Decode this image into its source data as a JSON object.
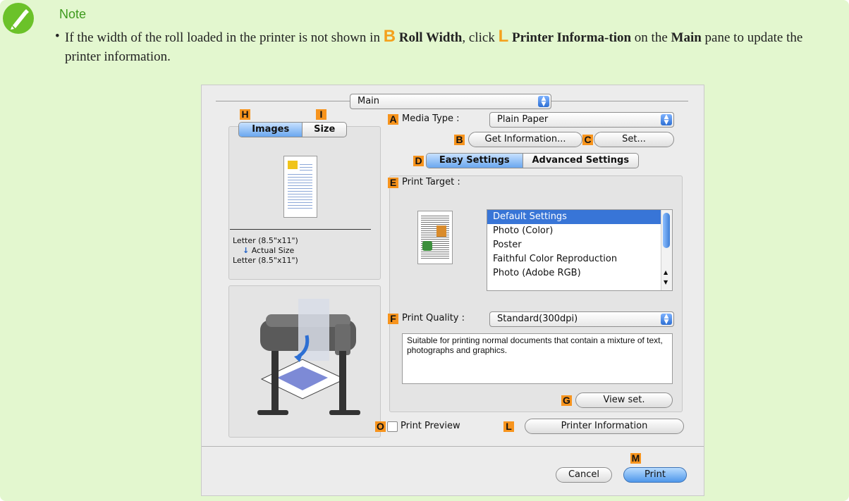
{
  "note": {
    "title": "Note",
    "bullet": "•",
    "text_1": "If the width of the roll loaded in the printer is not shown in",
    "badge_b": "B",
    "roll_width": "Roll Width",
    "text_2": ", click",
    "badge_l": "L",
    "printer_information_bold": "Printer Informa-tion",
    "text_3": "on the",
    "main_bold": "Main",
    "text_4": "pane to update the printer information."
  },
  "dialog": {
    "pane_popup": "Main",
    "tabs": {
      "label_h": "H",
      "label_i": "I",
      "images": "Images",
      "size": "Size"
    },
    "preview": {
      "paper_in": "Letter (8.5\"x11\")",
      "arrow": "↓",
      "actual_size": "Actual Size",
      "paper_out": "Letter (8.5\"x11\")"
    },
    "media_type": {
      "label_letter": "A",
      "label": "Media Type :",
      "value": "Plain Paper"
    },
    "get_info": {
      "label_letter": "B",
      "label": "Get Information..."
    },
    "set": {
      "label_letter": "C",
      "label": "Set..."
    },
    "settings_tabs": {
      "label_letter": "D",
      "easy": "Easy Settings",
      "advanced": "Advanced Settings"
    },
    "print_target": {
      "label_letter": "E",
      "label": "Print Target :",
      "items": [
        "Default Settings",
        "Photo (Color)",
        "Poster",
        "Faithful Color Reproduction",
        "Photo (Adobe RGB)"
      ],
      "selected": "Default Settings"
    },
    "print_quality": {
      "label_letter": "F",
      "label": "Print Quality :",
      "value": "Standard(300dpi)",
      "description": "Suitable for printing normal documents that contain a mixture of text, photographs and graphics."
    },
    "view_set": {
      "label_letter": "G",
      "label": "View set."
    },
    "print_preview": {
      "label_letter": "O",
      "label": "Print Preview"
    },
    "printer_information": {
      "label_letter": "L",
      "label": "Printer Information"
    },
    "cancel": "Cancel",
    "print": {
      "label_letter": "M",
      "label": "Print"
    }
  },
  "colors": {
    "note_bg": "#e3f7cf",
    "note_title": "#3e9a1d",
    "badge": "#f7941d",
    "selection": "#3875d7"
  }
}
